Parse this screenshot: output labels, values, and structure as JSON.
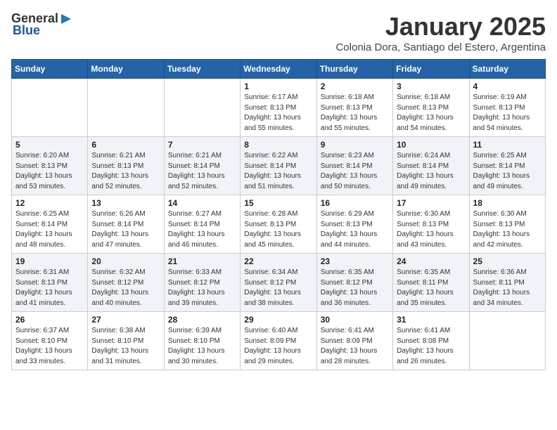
{
  "logo": {
    "general": "General",
    "blue": "Blue"
  },
  "title": "January 2025",
  "subtitle": "Colonia Dora, Santiago del Estero, Argentina",
  "days_of_week": [
    "Sunday",
    "Monday",
    "Tuesday",
    "Wednesday",
    "Thursday",
    "Friday",
    "Saturday"
  ],
  "weeks": [
    [
      {
        "day": "",
        "info": ""
      },
      {
        "day": "",
        "info": ""
      },
      {
        "day": "",
        "info": ""
      },
      {
        "day": "1",
        "info": "Sunrise: 6:17 AM\nSunset: 8:13 PM\nDaylight: 13 hours\nand 55 minutes."
      },
      {
        "day": "2",
        "info": "Sunrise: 6:18 AM\nSunset: 8:13 PM\nDaylight: 13 hours\nand 55 minutes."
      },
      {
        "day": "3",
        "info": "Sunrise: 6:18 AM\nSunset: 8:13 PM\nDaylight: 13 hours\nand 54 minutes."
      },
      {
        "day": "4",
        "info": "Sunrise: 6:19 AM\nSunset: 8:13 PM\nDaylight: 13 hours\nand 54 minutes."
      }
    ],
    [
      {
        "day": "5",
        "info": "Sunrise: 6:20 AM\nSunset: 8:13 PM\nDaylight: 13 hours\nand 53 minutes."
      },
      {
        "day": "6",
        "info": "Sunrise: 6:21 AM\nSunset: 8:13 PM\nDaylight: 13 hours\nand 52 minutes."
      },
      {
        "day": "7",
        "info": "Sunrise: 6:21 AM\nSunset: 8:14 PM\nDaylight: 13 hours\nand 52 minutes."
      },
      {
        "day": "8",
        "info": "Sunrise: 6:22 AM\nSunset: 8:14 PM\nDaylight: 13 hours\nand 51 minutes."
      },
      {
        "day": "9",
        "info": "Sunrise: 6:23 AM\nSunset: 8:14 PM\nDaylight: 13 hours\nand 50 minutes."
      },
      {
        "day": "10",
        "info": "Sunrise: 6:24 AM\nSunset: 8:14 PM\nDaylight: 13 hours\nand 49 minutes."
      },
      {
        "day": "11",
        "info": "Sunrise: 6:25 AM\nSunset: 8:14 PM\nDaylight: 13 hours\nand 49 minutes."
      }
    ],
    [
      {
        "day": "12",
        "info": "Sunrise: 6:25 AM\nSunset: 8:14 PM\nDaylight: 13 hours\nand 48 minutes."
      },
      {
        "day": "13",
        "info": "Sunrise: 6:26 AM\nSunset: 8:14 PM\nDaylight: 13 hours\nand 47 minutes."
      },
      {
        "day": "14",
        "info": "Sunrise: 6:27 AM\nSunset: 8:14 PM\nDaylight: 13 hours\nand 46 minutes."
      },
      {
        "day": "15",
        "info": "Sunrise: 6:28 AM\nSunset: 8:13 PM\nDaylight: 13 hours\nand 45 minutes."
      },
      {
        "day": "16",
        "info": "Sunrise: 6:29 AM\nSunset: 8:13 PM\nDaylight: 13 hours\nand 44 minutes."
      },
      {
        "day": "17",
        "info": "Sunrise: 6:30 AM\nSunset: 8:13 PM\nDaylight: 13 hours\nand 43 minutes."
      },
      {
        "day": "18",
        "info": "Sunrise: 6:30 AM\nSunset: 8:13 PM\nDaylight: 13 hours\nand 42 minutes."
      }
    ],
    [
      {
        "day": "19",
        "info": "Sunrise: 6:31 AM\nSunset: 8:13 PM\nDaylight: 13 hours\nand 41 minutes."
      },
      {
        "day": "20",
        "info": "Sunrise: 6:32 AM\nSunset: 8:12 PM\nDaylight: 13 hours\nand 40 minutes."
      },
      {
        "day": "21",
        "info": "Sunrise: 6:33 AM\nSunset: 8:12 PM\nDaylight: 13 hours\nand 39 minutes."
      },
      {
        "day": "22",
        "info": "Sunrise: 6:34 AM\nSunset: 8:12 PM\nDaylight: 13 hours\nand 38 minutes."
      },
      {
        "day": "23",
        "info": "Sunrise: 6:35 AM\nSunset: 8:12 PM\nDaylight: 13 hours\nand 36 minutes."
      },
      {
        "day": "24",
        "info": "Sunrise: 6:35 AM\nSunset: 8:11 PM\nDaylight: 13 hours\nand 35 minutes."
      },
      {
        "day": "25",
        "info": "Sunrise: 6:36 AM\nSunset: 8:11 PM\nDaylight: 13 hours\nand 34 minutes."
      }
    ],
    [
      {
        "day": "26",
        "info": "Sunrise: 6:37 AM\nSunset: 8:10 PM\nDaylight: 13 hours\nand 33 minutes."
      },
      {
        "day": "27",
        "info": "Sunrise: 6:38 AM\nSunset: 8:10 PM\nDaylight: 13 hours\nand 31 minutes."
      },
      {
        "day": "28",
        "info": "Sunrise: 6:39 AM\nSunset: 8:10 PM\nDaylight: 13 hours\nand 30 minutes."
      },
      {
        "day": "29",
        "info": "Sunrise: 6:40 AM\nSunset: 8:09 PM\nDaylight: 13 hours\nand 29 minutes."
      },
      {
        "day": "30",
        "info": "Sunrise: 6:41 AM\nSunset: 8:09 PM\nDaylight: 13 hours\nand 28 minutes."
      },
      {
        "day": "31",
        "info": "Sunrise: 6:41 AM\nSunset: 8:08 PM\nDaylight: 13 hours\nand 26 minutes."
      },
      {
        "day": "",
        "info": ""
      }
    ]
  ]
}
